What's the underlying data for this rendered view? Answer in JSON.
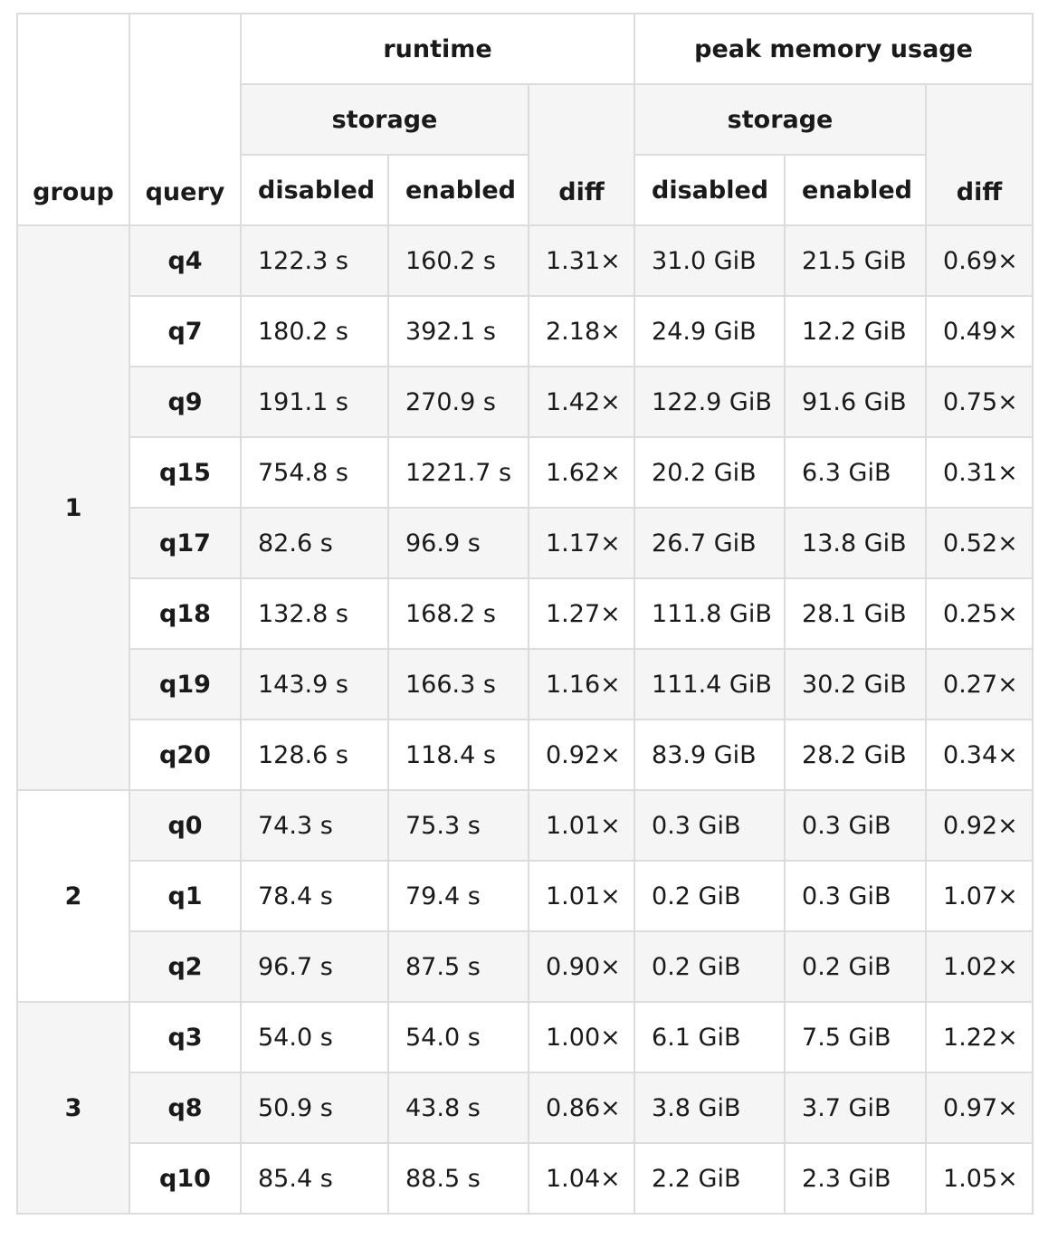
{
  "header": {
    "group": "group",
    "query": "query",
    "runtime": "runtime",
    "peak_memory": "peak memory usage",
    "storage_runtime": "storage",
    "storage_memory": "storage",
    "disabled_runtime": "disabled",
    "enabled_runtime": "enabled",
    "diff_runtime": "diff",
    "disabled_memory": "disabled",
    "enabled_memory": "enabled",
    "diff_memory": "diff"
  },
  "groups": [
    {
      "label": "1",
      "rows": [
        {
          "query": "q4",
          "rt_disabled": "122.3 s",
          "rt_enabled": "160.2 s",
          "rt_diff": "1.31×",
          "mem_disabled": "31.0 GiB",
          "mem_enabled": "21.5 GiB",
          "mem_diff": "0.69×"
        },
        {
          "query": "q7",
          "rt_disabled": "180.2 s",
          "rt_enabled": "392.1 s",
          "rt_diff": "2.18×",
          "mem_disabled": "24.9 GiB",
          "mem_enabled": "12.2 GiB",
          "mem_diff": "0.49×"
        },
        {
          "query": "q9",
          "rt_disabled": "191.1 s",
          "rt_enabled": "270.9 s",
          "rt_diff": "1.42×",
          "mem_disabled": "122.9 GiB",
          "mem_enabled": "91.6 GiB",
          "mem_diff": "0.75×"
        },
        {
          "query": "q15",
          "rt_disabled": "754.8 s",
          "rt_enabled": "1221.7 s",
          "rt_diff": "1.62×",
          "mem_disabled": "20.2 GiB",
          "mem_enabled": "6.3 GiB",
          "mem_diff": "0.31×"
        },
        {
          "query": "q17",
          "rt_disabled": "82.6 s",
          "rt_enabled": "96.9 s",
          "rt_diff": "1.17×",
          "mem_disabled": "26.7 GiB",
          "mem_enabled": "13.8 GiB",
          "mem_diff": "0.52×"
        },
        {
          "query": "q18",
          "rt_disabled": "132.8 s",
          "rt_enabled": "168.2 s",
          "rt_diff": "1.27×",
          "mem_disabled": "111.8 GiB",
          "mem_enabled": "28.1 GiB",
          "mem_diff": "0.25×"
        },
        {
          "query": "q19",
          "rt_disabled": "143.9 s",
          "rt_enabled": "166.3 s",
          "rt_diff": "1.16×",
          "mem_disabled": "111.4 GiB",
          "mem_enabled": "30.2 GiB",
          "mem_diff": "0.27×"
        },
        {
          "query": "q20",
          "rt_disabled": "128.6 s",
          "rt_enabled": "118.4 s",
          "rt_diff": "0.92×",
          "mem_disabled": "83.9 GiB",
          "mem_enabled": "28.2 GiB",
          "mem_diff": "0.34×"
        }
      ]
    },
    {
      "label": "2",
      "rows": [
        {
          "query": "q0",
          "rt_disabled": "74.3 s",
          "rt_enabled": "75.3 s",
          "rt_diff": "1.01×",
          "mem_disabled": "0.3 GiB",
          "mem_enabled": "0.3 GiB",
          "mem_diff": "0.92×"
        },
        {
          "query": "q1",
          "rt_disabled": "78.4 s",
          "rt_enabled": "79.4 s",
          "rt_diff": "1.01×",
          "mem_disabled": "0.2 GiB",
          "mem_enabled": "0.3 GiB",
          "mem_diff": "1.07×"
        },
        {
          "query": "q2",
          "rt_disabled": "96.7 s",
          "rt_enabled": "87.5 s",
          "rt_diff": "0.90×",
          "mem_disabled": "0.2 GiB",
          "mem_enabled": "0.2 GiB",
          "mem_diff": "1.02×"
        }
      ]
    },
    {
      "label": "3",
      "rows": [
        {
          "query": "q3",
          "rt_disabled": "54.0 s",
          "rt_enabled": "54.0 s",
          "rt_diff": "1.00×",
          "mem_disabled": "6.1 GiB",
          "mem_enabled": "7.5 GiB",
          "mem_diff": "1.22×"
        },
        {
          "query": "q8",
          "rt_disabled": "50.9 s",
          "rt_enabled": "43.8 s",
          "rt_diff": "0.86×",
          "mem_disabled": "3.8 GiB",
          "mem_enabled": "3.7 GiB",
          "mem_diff": "0.97×"
        },
        {
          "query": "q10",
          "rt_disabled": "85.4 s",
          "rt_enabled": "88.5 s",
          "rt_diff": "1.04×",
          "mem_disabled": "2.2 GiB",
          "mem_enabled": "2.3 GiB",
          "mem_diff": "1.05×"
        }
      ]
    }
  ],
  "colors": {
    "stripe": "#f5f5f5",
    "border": "#dcdcdc",
    "text": "#1a1a1a"
  }
}
